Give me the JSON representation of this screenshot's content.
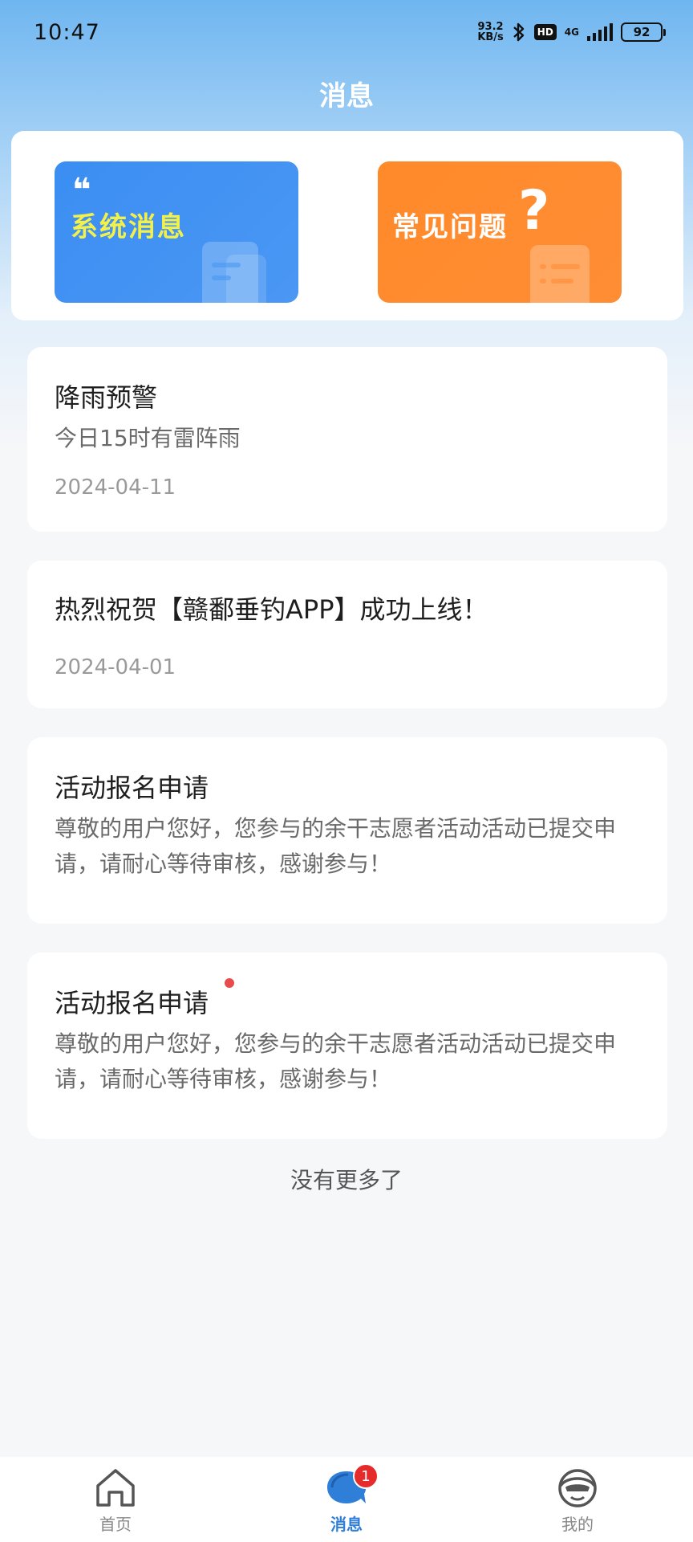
{
  "status_bar": {
    "time": "10:47",
    "net_speed_value": "93.2",
    "net_speed_unit": "KB/s",
    "hd": "HD",
    "network": "4G",
    "battery": "92"
  },
  "header": {
    "title": "消息"
  },
  "entries": {
    "system_messages": {
      "label": "系统消息",
      "quote": "❝"
    },
    "faq": {
      "label": "常见问题",
      "qmark": "?"
    }
  },
  "messages": [
    {
      "title": "降雨预警",
      "body": "今日15时有雷阵雨",
      "date": "2024-04-11",
      "unread": false
    },
    {
      "title": "热烈祝贺【赣鄱垂钓APP】成功上线！",
      "body": "",
      "date": "2024-04-01",
      "unread": false
    },
    {
      "title": "活动报名申请",
      "body": "尊敬的用户您好，您参与的余干志愿者活动活动已提交申请，请耐心等待审核，感谢参与！",
      "date": "",
      "unread": false
    },
    {
      "title": "活动报名申请",
      "body": "尊敬的用户您好，您参与的余干志愿者活动活动已提交申请，请耐心等待审核，感谢参与！",
      "date": "",
      "unread": true
    }
  ],
  "list_footer": "没有更多了",
  "bottom_nav": {
    "items": [
      {
        "label": "首页",
        "icon": "home-icon",
        "active": false
      },
      {
        "label": "消息",
        "icon": "chat-bubble-icon",
        "active": true,
        "badge": "1"
      },
      {
        "label": "我的",
        "icon": "profile-face-icon",
        "active": false
      }
    ]
  },
  "colors": {
    "accent": "#2f7ed8",
    "system_card": "#3b8ef2",
    "faq_card": "#ff8a2a",
    "system_label": "#f4f04a",
    "badge": "#e52b2b"
  }
}
